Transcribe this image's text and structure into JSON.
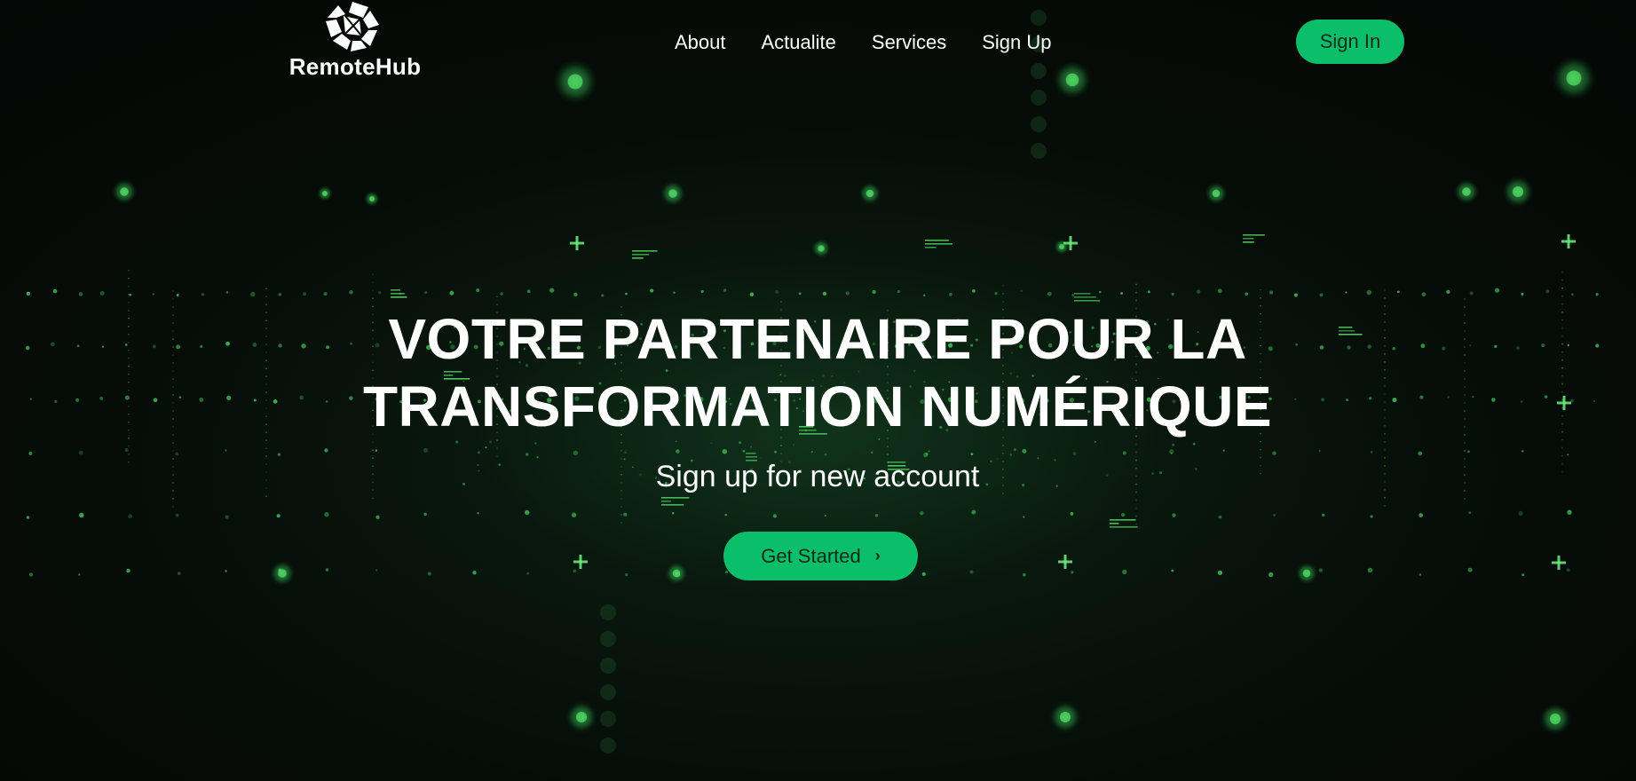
{
  "brand": {
    "name": "RemoteHub",
    "logo_icon": "remotehub-logo-icon"
  },
  "nav": {
    "items": [
      {
        "label": "About"
      },
      {
        "label": "Actualite"
      },
      {
        "label": "Services"
      },
      {
        "label": "Sign Up"
      }
    ],
    "signin_label": "Sign In"
  },
  "hero": {
    "title_line1": "VOTRE PARTENAIRE POUR LA",
    "title_line2": "TRANSFORMATION NUMÉRIQUE",
    "subtitle": "Sign up for new account",
    "cta_label": "Get Started",
    "cta_icon": "chevron-right-icon"
  },
  "colors": {
    "accent": "#0bbf6a",
    "accent_text": "#0b2a18",
    "background": "#060b08",
    "glow": "#5dff7a"
  }
}
